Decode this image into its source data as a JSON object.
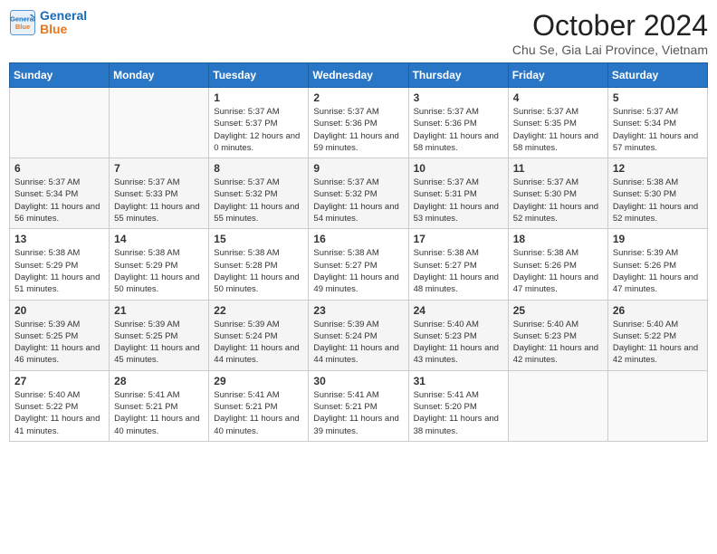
{
  "header": {
    "logo_line1": "General",
    "logo_line2": "Blue",
    "title": "October 2024",
    "subtitle": "Chu Se, Gia Lai Province, Vietnam"
  },
  "days_of_week": [
    "Sunday",
    "Monday",
    "Tuesday",
    "Wednesday",
    "Thursday",
    "Friday",
    "Saturday"
  ],
  "weeks": [
    [
      {
        "day": "",
        "empty": true
      },
      {
        "day": "",
        "empty": true
      },
      {
        "day": "1",
        "sunrise": "5:37 AM",
        "sunset": "5:37 PM",
        "daylight": "12 hours and 0 minutes."
      },
      {
        "day": "2",
        "sunrise": "5:37 AM",
        "sunset": "5:36 PM",
        "daylight": "11 hours and 59 minutes."
      },
      {
        "day": "3",
        "sunrise": "5:37 AM",
        "sunset": "5:36 PM",
        "daylight": "11 hours and 58 minutes."
      },
      {
        "day": "4",
        "sunrise": "5:37 AM",
        "sunset": "5:35 PM",
        "daylight": "11 hours and 58 minutes."
      },
      {
        "day": "5",
        "sunrise": "5:37 AM",
        "sunset": "5:34 PM",
        "daylight": "11 hours and 57 minutes."
      }
    ],
    [
      {
        "day": "6",
        "sunrise": "5:37 AM",
        "sunset": "5:34 PM",
        "daylight": "11 hours and 56 minutes."
      },
      {
        "day": "7",
        "sunrise": "5:37 AM",
        "sunset": "5:33 PM",
        "daylight": "11 hours and 55 minutes."
      },
      {
        "day": "8",
        "sunrise": "5:37 AM",
        "sunset": "5:32 PM",
        "daylight": "11 hours and 55 minutes."
      },
      {
        "day": "9",
        "sunrise": "5:37 AM",
        "sunset": "5:32 PM",
        "daylight": "11 hours and 54 minutes."
      },
      {
        "day": "10",
        "sunrise": "5:37 AM",
        "sunset": "5:31 PM",
        "daylight": "11 hours and 53 minutes."
      },
      {
        "day": "11",
        "sunrise": "5:37 AM",
        "sunset": "5:30 PM",
        "daylight": "11 hours and 52 minutes."
      },
      {
        "day": "12",
        "sunrise": "5:38 AM",
        "sunset": "5:30 PM",
        "daylight": "11 hours and 52 minutes."
      }
    ],
    [
      {
        "day": "13",
        "sunrise": "5:38 AM",
        "sunset": "5:29 PM",
        "daylight": "11 hours and 51 minutes."
      },
      {
        "day": "14",
        "sunrise": "5:38 AM",
        "sunset": "5:29 PM",
        "daylight": "11 hours and 50 minutes."
      },
      {
        "day": "15",
        "sunrise": "5:38 AM",
        "sunset": "5:28 PM",
        "daylight": "11 hours and 50 minutes."
      },
      {
        "day": "16",
        "sunrise": "5:38 AM",
        "sunset": "5:27 PM",
        "daylight": "11 hours and 49 minutes."
      },
      {
        "day": "17",
        "sunrise": "5:38 AM",
        "sunset": "5:27 PM",
        "daylight": "11 hours and 48 minutes."
      },
      {
        "day": "18",
        "sunrise": "5:38 AM",
        "sunset": "5:26 PM",
        "daylight": "11 hours and 47 minutes."
      },
      {
        "day": "19",
        "sunrise": "5:39 AM",
        "sunset": "5:26 PM",
        "daylight": "11 hours and 47 minutes."
      }
    ],
    [
      {
        "day": "20",
        "sunrise": "5:39 AM",
        "sunset": "5:25 PM",
        "daylight": "11 hours and 46 minutes."
      },
      {
        "day": "21",
        "sunrise": "5:39 AM",
        "sunset": "5:25 PM",
        "daylight": "11 hours and 45 minutes."
      },
      {
        "day": "22",
        "sunrise": "5:39 AM",
        "sunset": "5:24 PM",
        "daylight": "11 hours and 44 minutes."
      },
      {
        "day": "23",
        "sunrise": "5:39 AM",
        "sunset": "5:24 PM",
        "daylight": "11 hours and 44 minutes."
      },
      {
        "day": "24",
        "sunrise": "5:40 AM",
        "sunset": "5:23 PM",
        "daylight": "11 hours and 43 minutes."
      },
      {
        "day": "25",
        "sunrise": "5:40 AM",
        "sunset": "5:23 PM",
        "daylight": "11 hours and 42 minutes."
      },
      {
        "day": "26",
        "sunrise": "5:40 AM",
        "sunset": "5:22 PM",
        "daylight": "11 hours and 42 minutes."
      }
    ],
    [
      {
        "day": "27",
        "sunrise": "5:40 AM",
        "sunset": "5:22 PM",
        "daylight": "11 hours and 41 minutes."
      },
      {
        "day": "28",
        "sunrise": "5:41 AM",
        "sunset": "5:21 PM",
        "daylight": "11 hours and 40 minutes."
      },
      {
        "day": "29",
        "sunrise": "5:41 AM",
        "sunset": "5:21 PM",
        "daylight": "11 hours and 40 minutes."
      },
      {
        "day": "30",
        "sunrise": "5:41 AM",
        "sunset": "5:21 PM",
        "daylight": "11 hours and 39 minutes."
      },
      {
        "day": "31",
        "sunrise": "5:41 AM",
        "sunset": "5:20 PM",
        "daylight": "11 hours and 38 minutes."
      },
      {
        "day": "",
        "empty": true
      },
      {
        "day": "",
        "empty": true
      }
    ]
  ]
}
